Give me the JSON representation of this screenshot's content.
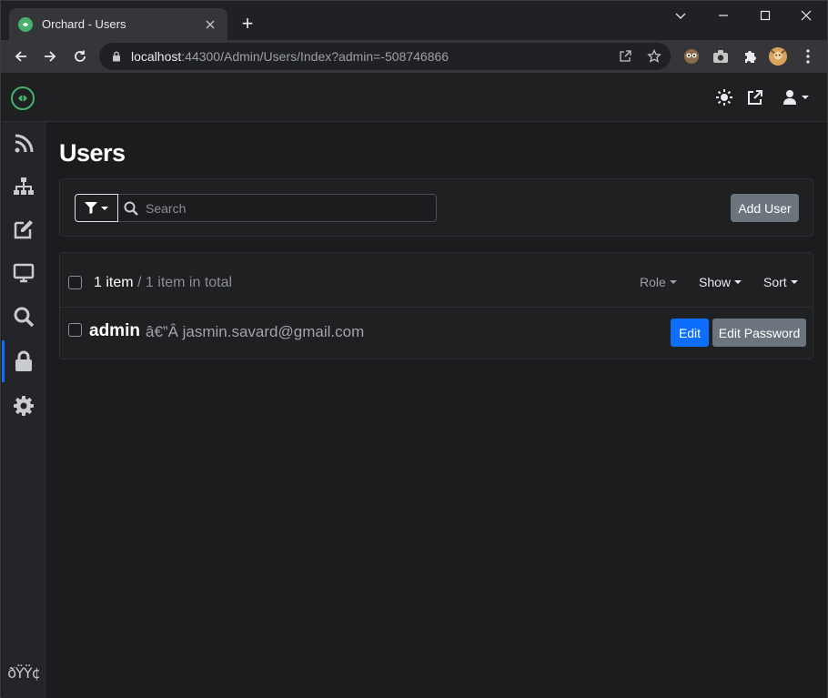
{
  "browser": {
    "tab_title": "Orchard - Users",
    "new_tab": "+",
    "url_host": "localhost",
    "url_rest": ":44300/Admin/Users/Index?admin=-508746866"
  },
  "sidebar": {
    "items": [
      {
        "icon": "rss-icon"
      },
      {
        "icon": "sitemap-icon"
      },
      {
        "icon": "edit-icon"
      },
      {
        "icon": "desktop-icon"
      },
      {
        "icon": "search-icon"
      },
      {
        "icon": "lock-icon",
        "active": true
      },
      {
        "icon": "gear-icon"
      }
    ],
    "bottom_text": "ðŸŸ¢"
  },
  "page": {
    "title": "Users",
    "search_placeholder": "Search",
    "add_user_label": "Add User"
  },
  "list": {
    "count_strong": "1 item",
    "count_muted": " / 1 item in total",
    "role_label": "Role",
    "show_label": "Show",
    "sort_label": "Sort",
    "rows": [
      {
        "name": "admin",
        "email": "â€”Â jasmin.savard@gmail.com",
        "edit_label": "Edit",
        "edit_password_label": "Edit Password"
      }
    ]
  },
  "colors": {
    "accent": "#0d6efd",
    "brand": "#48b06a",
    "secondary": "#6c757d"
  }
}
